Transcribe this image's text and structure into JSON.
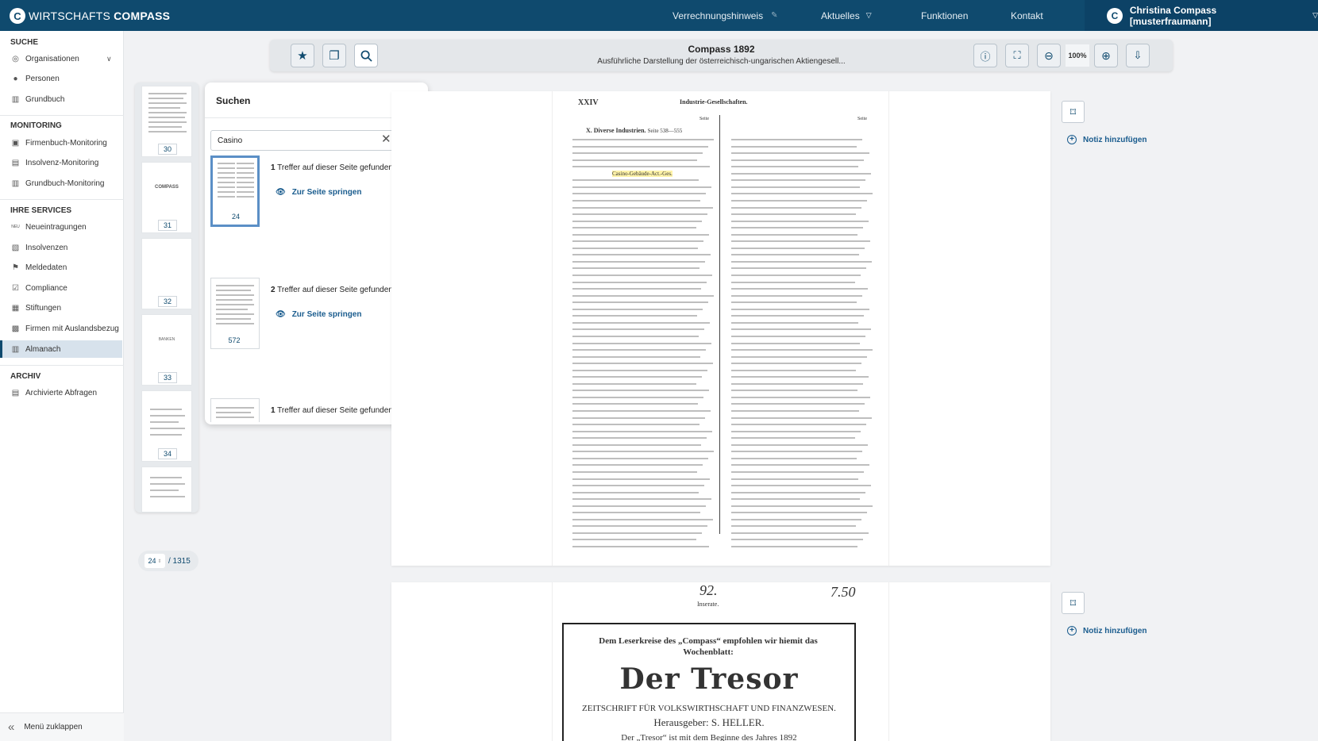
{
  "brand": {
    "light": "WIRTSCHAFTS",
    "bold": "COMPASS"
  },
  "nav": {
    "items": [
      "Verrechnungshinweis",
      "Aktuelles",
      "Funktionen",
      "Kontakt"
    ]
  },
  "user": {
    "name": "Christina Compass [musterfraumann]"
  },
  "sidebar": {
    "suche_heading": "SUCHE",
    "suche": [
      "Organisationen",
      "Personen",
      "Grundbuch"
    ],
    "monitoring_heading": "MONITORING",
    "monitoring": [
      "Firmenbuch-Monitoring",
      "Insolvenz-Monitoring",
      "Grundbuch-Monitoring"
    ],
    "services_heading": "IHRE SERVICES",
    "services": [
      "Neueintragungen",
      "Insolvenzen",
      "Meldedaten",
      "Compliance",
      "Stiftungen",
      "Firmen mit Auslandsbezug",
      "Almanach"
    ],
    "archiv_heading": "ARCHIV",
    "archiv": [
      "Archivierte Abfragen"
    ],
    "collapse": "Menü zuklappen",
    "new_badge": "NEU"
  },
  "toolbar": {
    "title": "Compass 1892",
    "subtitle": "Ausführliche Darstellung der österreichisch-ungarischen Aktiengesell...",
    "zoom": "100%"
  },
  "thumbnails": [
    "30",
    "31",
    "32",
    "33",
    "34"
  ],
  "thumb_text": {
    "t31": "COMPASS",
    "t33": "BANKEN"
  },
  "pager": {
    "current": "24",
    "total": "/ 1315"
  },
  "search": {
    "title": "Suchen",
    "query": "Casino",
    "results": [
      {
        "page": "24",
        "count": "1",
        "suffix": "Treffer auf dieser Seite gefunden",
        "link": "Zur Seite springen"
      },
      {
        "page": "572",
        "count": "2",
        "suffix": "Treffer auf dieser Seite gefunden",
        "link": "Zur Seite springen"
      },
      {
        "page": "",
        "count": "1",
        "suffix": "Treffer auf dieser Seite gefunden",
        "link": ""
      }
    ]
  },
  "page1": {
    "num": "XXIV",
    "heading": "Industrie-Gesellschaften.",
    "section": "X. Diverse Industrien.",
    "section_range": "Seite 538—555",
    "col_label": "Seite",
    "highlight": "Casino-Gebäude-Act.-Ges."
  },
  "page2": {
    "handwritten_left": "92.",
    "handwritten_right": "7.50",
    "label": "Inserate.",
    "intro": "Dem Leserkreise des „Compass“ empfohlen wir hiemit das Wochenblatt:",
    "masthead": "Der Tresor",
    "subtitle": "ZEITSCHRIFT FÜR VOLKSWIRTHSCHAFT UND FINANZWESEN.",
    "editor": "Herausgeber: S. HELLER.",
    "body": "Der „Tresor“ ist mit dem Beginne des Jahres 1892"
  },
  "notes": {
    "label": "Notiz hinzufügen"
  }
}
